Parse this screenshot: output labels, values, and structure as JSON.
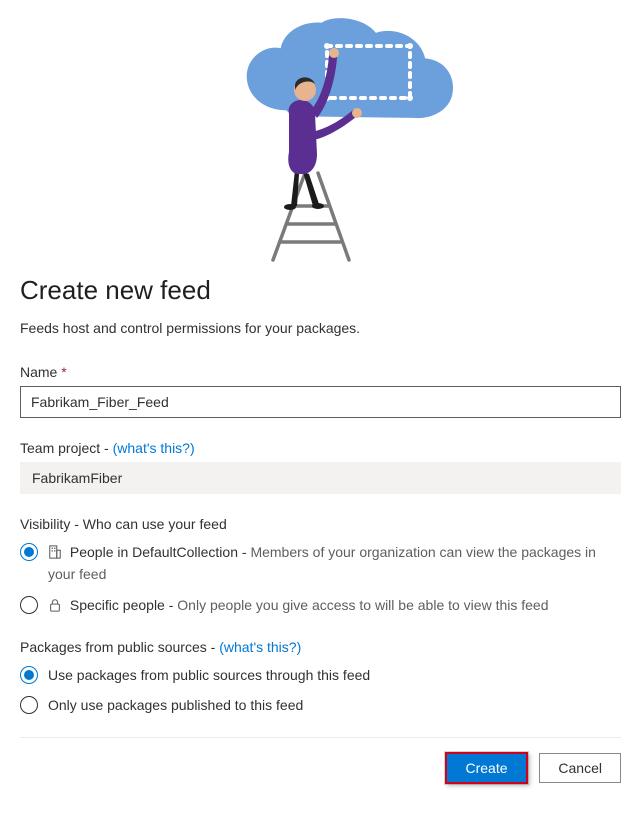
{
  "title": "Create new feed",
  "subtitle": "Feeds host and control permissions for your packages.",
  "name_field": {
    "label": "Name",
    "required_marker": "*",
    "value": "Fabrikam_Fiber_Feed"
  },
  "team_project": {
    "label": "Team project -",
    "link": "(what's this?)",
    "value": "FabrikamFiber"
  },
  "visibility": {
    "label": "Visibility - Who can use your feed",
    "options": [
      {
        "strong": "People in DefaultCollection -",
        "rest": "Members of your organization can view the packages in your feed",
        "checked": true,
        "icon": "org-icon"
      },
      {
        "strong": "Specific people -",
        "rest": "Only people you give access to will be able to view this feed",
        "checked": false,
        "icon": "lock-icon"
      }
    ]
  },
  "public_sources": {
    "label": "Packages from public sources -",
    "link": "(what's this?)",
    "options": [
      {
        "label": "Use packages from public sources through this feed",
        "checked": true
      },
      {
        "label": "Only use packages published to this feed",
        "checked": false
      }
    ]
  },
  "buttons": {
    "create": "Create",
    "cancel": "Cancel"
  }
}
